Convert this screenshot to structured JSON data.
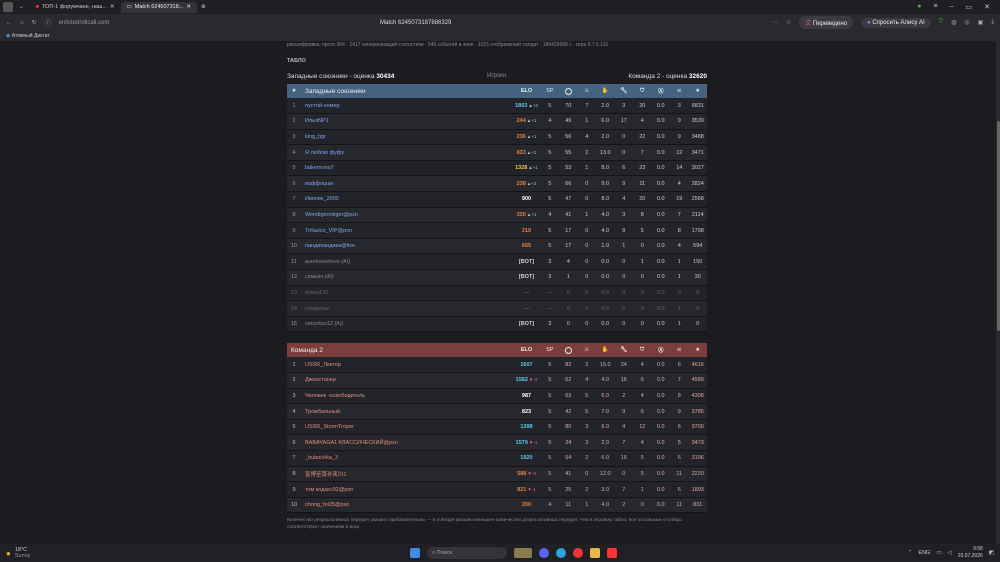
{
  "browser": {
    "tabs": [
      {
        "label": "ТОП-1 форумчане, наш..."
      },
      {
        "label": "Match 624507318..."
      }
    ],
    "url": "enlistedrollcall.com",
    "page_title": "Match 6245073187886329",
    "translated_label": "Переведено",
    "alice_label": "Спросить Алису AI",
    "bookmark": "Атомный Диктат"
  },
  "page": {
    "decode_text": "расшифровка: прото 304 · 2417 синхронизаций статистики · 540 событий в зоне · 1015 отображений солдат · 186429668 с · игра 0.7.5.116",
    "section_label": "ТАБЛО",
    "score_left_label": "Западные союзники - оценка",
    "score_left_value": "30434",
    "score_mid": "Игроки",
    "score_right_label": "Команда 2 - оценка",
    "score_right_value": "32620",
    "footnote": "Количество результативных передач указано приблизительно — в повторе указано меньшее количество результативных передач, чем в игровом табло; все остальные столбцы соответствуют значениям в игре."
  },
  "team1": {
    "name": "Западные союзники",
    "elo_label": "ELO",
    "sp_label": "SP",
    "rows": [
      {
        "n": "1",
        "name": "пустой номер",
        "elo": "1803",
        "d": "▲+2",
        "ec": "hi-cyan",
        "c": [
          "5",
          "70",
          "7",
          "2.0",
          "3",
          "20",
          "0.0",
          "3",
          "6831"
        ]
      },
      {
        "n": "2",
        "name": "ИльяNP1",
        "elo": "244",
        "d": "▲+1",
        "ec": "hi-orange",
        "c": [
          "4",
          "49",
          "1",
          "6.0",
          "17",
          "4",
          "0.0",
          "9",
          "3539"
        ]
      },
      {
        "n": "3",
        "name": "king_tigr",
        "elo": "236",
        "d": "▲+1",
        "ec": "hi-orange",
        "c": [
          "5",
          "56",
          "4",
          "2.0",
          "0",
          "22",
          "0.0",
          "9",
          "3488"
        ]
      },
      {
        "n": "4",
        "name": "Я люблю фуфу",
        "elo": "833",
        "d": "▲+2",
        "ec": "hi-orange",
        "c": [
          "5",
          "55",
          "2",
          "13.0",
          "0",
          "7",
          "0.0",
          "12",
          "3471"
        ]
      },
      {
        "n": "5",
        "name": "bakemono7",
        "elo": "1328",
        "d": "▲+1",
        "ec": "hi-yellow",
        "c": [
          "5",
          "53",
          "1",
          "8.0",
          "6",
          "23",
          "0.0",
          "14",
          "3027"
        ]
      },
      {
        "n": "6",
        "name": "ваффлшан",
        "elo": "238",
        "d": "▲+2",
        "ec": "hi-orange",
        "c": [
          "5",
          "66",
          "0",
          "9.0",
          "9",
          "11",
          "0.0",
          "4",
          "2824"
        ]
      },
      {
        "n": "7",
        "name": "Иволек_2000",
        "elo": "900",
        "d": "",
        "ec": "hi-white",
        "c": [
          "5",
          "47",
          "0",
          "8.0",
          "4",
          "20",
          "0.0",
          "19",
          "2568"
        ]
      },
      {
        "n": "8",
        "name": "Wendigirontiger@psn",
        "elo": "330",
        "d": "▲+1",
        "ec": "hi-orange",
        "c": [
          "4",
          "41",
          "1",
          "4.0",
          "3",
          "8",
          "0.0",
          "7",
          "2114"
        ]
      },
      {
        "n": "9",
        "name": "Trifasico_VIP@psn",
        "elo": "210",
        "d": "",
        "ec": "hi-orange",
        "c": [
          "5",
          "17",
          "0",
          "4.0",
          "9",
          "5",
          "0.0",
          "8",
          "1798"
        ]
      },
      {
        "n": "10",
        "name": "пандапандика@live",
        "elo": "665",
        "d": "",
        "ec": "hi-orange",
        "c": [
          "5",
          "17",
          "0",
          "1.0",
          "1",
          "0",
          "0.0",
          "4",
          "594"
        ]
      },
      {
        "n": "11",
        "name": "винтоледена (AI)",
        "elo": "[BOT]",
        "d": "",
        "ec": "",
        "ai": true,
        "c": [
          "3",
          "4",
          "0",
          "0.0",
          "0",
          "1",
          "0.0",
          "1",
          "150"
        ]
      },
      {
        "n": "12",
        "name": "семьян (AI)",
        "elo": "[BOT]",
        "d": "",
        "ec": "",
        "ai": true,
        "c": [
          "3",
          "1",
          "0",
          "0.0",
          "0",
          "0",
          "0.0",
          "1",
          "30"
        ]
      },
      {
        "n": "13",
        "name": "bviwa120",
        "elo": "—",
        "d": "",
        "ec": "",
        "dim": true,
        "c": [
          "—",
          "0",
          "0",
          "0.0",
          "0",
          "0",
          "0.0",
          "0",
          "0"
        ]
      },
      {
        "n": "14",
        "name": "сокартис",
        "elo": "—",
        "d": "",
        "ec": "",
        "dim": true,
        "c": [
          "—",
          "0",
          "0",
          "0.0",
          "0",
          "0",
          "0.0",
          "1",
          "0"
        ]
      },
      {
        "n": "15",
        "name": "senzdovi12 (AI)",
        "elo": "[BOT]",
        "d": "",
        "ec": "",
        "ai": true,
        "c": [
          "3",
          "0",
          "0",
          "0.0",
          "0",
          "0",
          "0.0",
          "1",
          "0"
        ]
      }
    ]
  },
  "team2": {
    "name": "Команда 2",
    "elo_label": "ELO",
    "sp_label": "SP",
    "rows": [
      {
        "n": "1",
        "name": "USSR_Лектор",
        "elo": "1607",
        "d": "",
        "ec": "hi-cyan",
        "c": [
          "5",
          "82",
          "2",
          "15.0",
          "24",
          "4",
          "0.0",
          "6",
          "4616"
        ]
      },
      {
        "n": "2",
        "name": "Джонстонер",
        "elo": "1582",
        "d": "▼-3",
        "ec": "hi-cyan",
        "neg": true,
        "c": [
          "5",
          "62",
          "4",
          "4.0",
          "16",
          "6",
          "0.0",
          "7",
          "4589"
        ]
      },
      {
        "n": "3",
        "name": "Человек -освободитель",
        "elo": "987",
        "d": "",
        "ec": "hi-white",
        "c": [
          "5",
          "63",
          "5",
          "6.0",
          "2",
          "4",
          "0.0",
          "8",
          "4308"
        ]
      },
      {
        "n": "4",
        "name": "Трожбальный",
        "elo": "823",
        "d": "",
        "ec": "hi-white",
        "c": [
          "5",
          "42",
          "5",
          "7.0",
          "9",
          "6",
          "0.0",
          "9",
          "3785"
        ]
      },
      {
        "n": "5",
        "name": "USSR_StormTroper",
        "elo": "1398",
        "d": "",
        "ec": "hi-cyan",
        "c": [
          "5",
          "80",
          "3",
          "6.0",
          "4",
          "12",
          "0.0",
          "6",
          "3709"
        ]
      },
      {
        "n": "6",
        "name": "BABAYAGA1 КЛАССИЧЕСКИЙ@psn",
        "elo": "1579",
        "d": "▼-1",
        "ec": "hi-cyan",
        "neg": true,
        "c": [
          "5",
          "24",
          "3",
          "2.0",
          "7",
          "4",
          "0.0",
          "5",
          "3473"
        ]
      },
      {
        "n": "7",
        "name": "_bubochka_3",
        "elo": "1920",
        "d": "",
        "ec": "hi-cyan",
        "c": [
          "5",
          "54",
          "2",
          "6.0",
          "15",
          "5",
          "0.0",
          "6",
          "3196"
        ]
      },
      {
        "n": "8",
        "name": "富博至尊孙笑川1",
        "elo": "588",
        "d": "▼-3",
        "ec": "hi-orange",
        "neg": true,
        "c": [
          "5",
          "41",
          "0",
          "12.0",
          "0",
          "5",
          "0.0",
          "11",
          "2220"
        ]
      },
      {
        "n": "9",
        "name": "том кодкес92@psn",
        "elo": "821",
        "d": "▼-1",
        "ec": "hi-orange",
        "neg": true,
        "c": [
          "5",
          "25",
          "2",
          "3.0",
          "7",
          "1",
          "0.0",
          "6",
          "1893"
        ]
      },
      {
        "n": "10",
        "name": "chong_fei25@psn",
        "elo": "200",
        "d": "",
        "ec": "hi-orange",
        "c": [
          "4",
          "11",
          "1",
          "4.0",
          "2",
          "0",
          "0.0",
          "11",
          "831"
        ]
      }
    ]
  },
  "taskbar": {
    "temp": "18°C",
    "weather": "Sunny",
    "search_placeholder": "Поиск",
    "lang": "ENG",
    "time": "9:58",
    "date": "29.07.2026"
  }
}
